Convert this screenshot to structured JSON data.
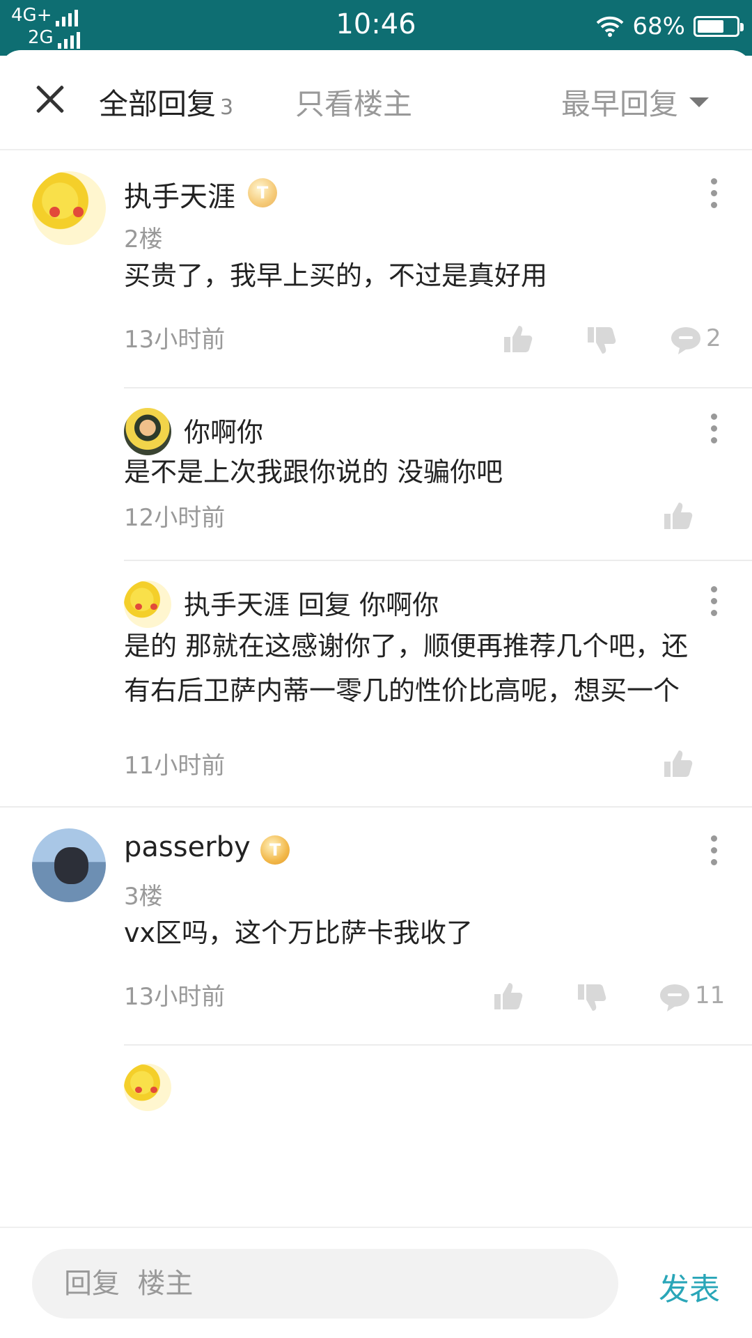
{
  "status_bar": {
    "network_top": "4G+",
    "network_bottom": "2G",
    "time": "10:46",
    "battery": "68%",
    "battery_level": 0.68
  },
  "header": {
    "close_icon": "close-icon",
    "tab_all": "全部回复",
    "tab_all_count": "3",
    "tab_owner_only": "只看楼主",
    "sort_label": "最早回复"
  },
  "comments": [
    {
      "user": "执手天涯",
      "level": "T",
      "floor": "2楼",
      "text": "买贵了，我早上买的，不过是真好用",
      "time": "13小时前",
      "reply_count": "2",
      "replies": [
        {
          "user": "你啊你",
          "text": "是不是上次我跟你说的  没骗你吧",
          "time": "12小时前"
        },
        {
          "user": "执手天涯 回复 你啊你",
          "text": "是的    那就在这感谢你了，顺便再推荐几个吧，还有右后卫萨内蒂一零几的性价比高呢，想买一个",
          "time": "11小时前"
        }
      ]
    },
    {
      "user": "passerby",
      "level": "T",
      "floor": "3楼",
      "text": "vx区吗，这个万比萨卡我收了",
      "time": "13小时前",
      "reply_count": "11"
    }
  ],
  "bottom_bar": {
    "reply_placeholder": "回复  楼主",
    "publish_label": "发表"
  },
  "colors": {
    "status_bar": "#0e6e72",
    "accent": "#2aa6b8"
  }
}
